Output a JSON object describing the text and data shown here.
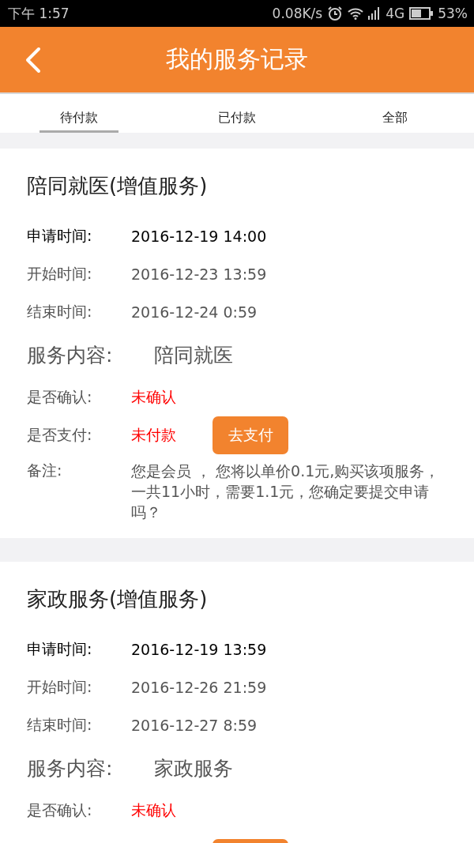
{
  "status_bar": {
    "time": "下午 1:57",
    "speed": "0.08K/s",
    "network": "4G",
    "battery": "53%"
  },
  "header": {
    "title": "我的服务记录"
  },
  "tabs": [
    {
      "label": "待付款",
      "selected": true
    },
    {
      "label": "已付款",
      "selected": false
    },
    {
      "label": "全部",
      "selected": false
    }
  ],
  "records": [
    {
      "title": "陪同就医(增值服务)",
      "rows": [
        {
          "kind": "time",
          "label": "申请时间:",
          "value": "2016-12-19 14:00",
          "emphasized": true
        },
        {
          "kind": "time",
          "label": "开始时间:",
          "value": "2016-12-23 13:59",
          "emphasized": false
        },
        {
          "kind": "time",
          "label": "结束时间:",
          "value": "2016-12-24 0:59",
          "emphasized": false
        },
        {
          "kind": "content",
          "label": "服务内容:",
          "value": "陪同就医"
        },
        {
          "kind": "status",
          "label": "是否确认:",
          "value": "未确认"
        },
        {
          "kind": "status",
          "label": "是否支付:",
          "value": "未付款",
          "button": "去支付"
        },
        {
          "kind": "note",
          "label": "备注:",
          "value": "您是会员 ，  您将以单价0.1元,购买该项服务，一共11小时，需要1.1元，您确定要提交申请吗？"
        }
      ]
    },
    {
      "title": "家政服务(增值服务)",
      "rows": [
        {
          "kind": "time",
          "label": "申请时间:",
          "value": "2016-12-19 13:59",
          "emphasized": true
        },
        {
          "kind": "time",
          "label": "开始时间:",
          "value": "2016-12-26 21:59",
          "emphasized": false
        },
        {
          "kind": "time",
          "label": "结束时间:",
          "value": "2016-12-27 8:59",
          "emphasized": false
        },
        {
          "kind": "content",
          "label": "服务内容:",
          "value": "家政服务"
        },
        {
          "kind": "status",
          "label": "是否确认:",
          "value": "未确认"
        },
        {
          "kind": "button-stub"
        }
      ]
    }
  ]
}
